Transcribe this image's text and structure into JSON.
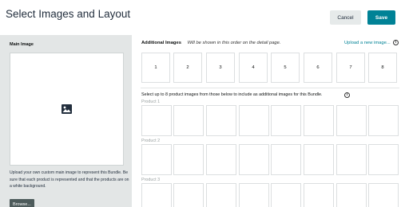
{
  "header": {
    "title": "Select Images and Layout",
    "cancel_label": "Cancel",
    "save_label": "Save"
  },
  "main_image": {
    "label": "Main Image",
    "placeholder_icon": "image-icon",
    "help_text": "Upload your own custom main image to represent this Bundle. Be sure that each product is represented and that the products are on a white background.",
    "browse_label": "Browse..."
  },
  "additional_images": {
    "label": "Additional Images",
    "note": "Will be shown in this order on the detail page.",
    "upload_link": "Upload a new image...",
    "slots": [
      "1",
      "2",
      "3",
      "4",
      "5",
      "6",
      "7",
      "8"
    ]
  },
  "product_selection": {
    "instruction": "Select up to 8 product images from those below to include as additional images for this Bundle.",
    "products": [
      {
        "label": "Product 1"
      },
      {
        "label": "Product 2"
      },
      {
        "label": "Product 3"
      }
    ]
  },
  "colors": {
    "accent": "#008296",
    "panel_bg": "#e3e6e6",
    "browse_bg": "#4d5b5b"
  }
}
